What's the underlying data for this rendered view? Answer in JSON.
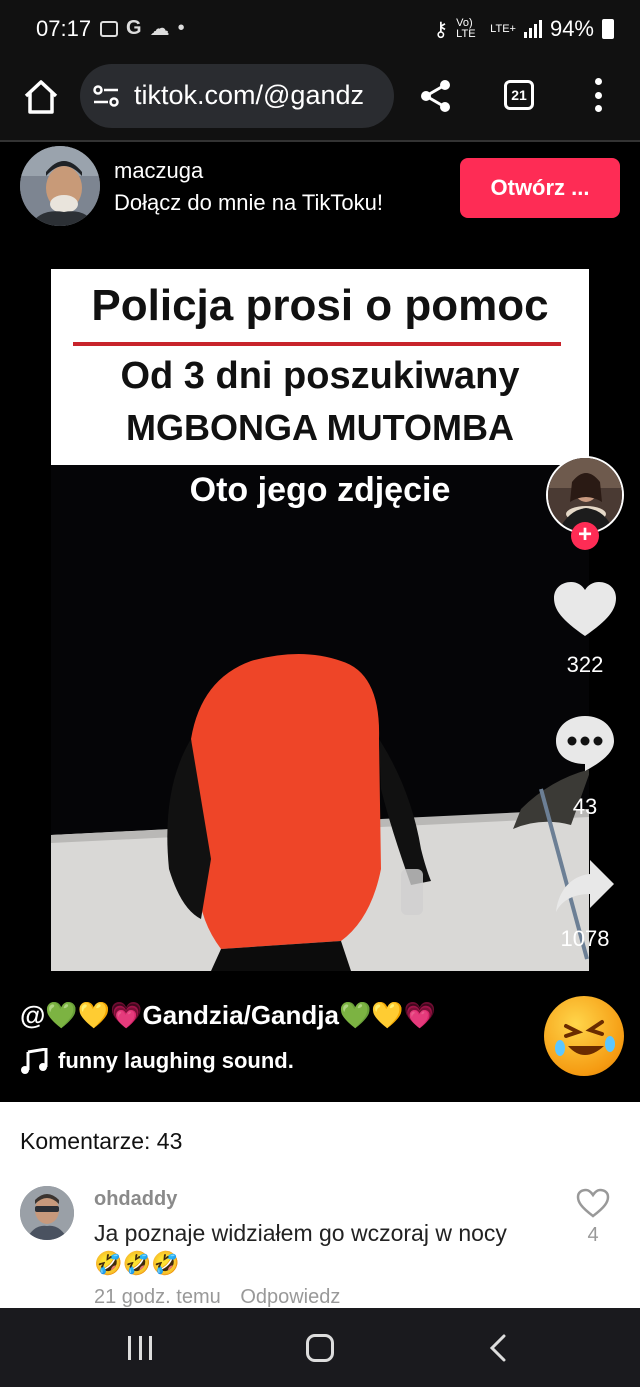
{
  "status_bar": {
    "time": "07:17",
    "left_icons": [
      "calendar-icon",
      "google-icon",
      "cloud-icon",
      "dot-icon"
    ],
    "network": "Vo) LTE",
    "data": "LTE+",
    "battery": "94%"
  },
  "browser": {
    "url": "tiktok.com/@gandz",
    "tab_count": "21"
  },
  "profile": {
    "username": "maczuga",
    "invite_text": "Dołącz do mnie na TikToku!",
    "open_button": "Otwórz ..."
  },
  "video": {
    "headline": "Policja prosi o pomoc",
    "line2": "Od 3 dni poszukiwany",
    "line3": "MGBONGA MUTOMBA",
    "caption": "Oto jego zdjęcie"
  },
  "actions": {
    "likes": "322",
    "comments": "43",
    "shares": "1078"
  },
  "post": {
    "author_credit": "@💚💛💗Gandzia/Gandja💚💛💗",
    "sound": "funny laughing sound."
  },
  "comments_section": {
    "heading": "Komentarze: 43",
    "items": [
      {
        "user": "ohdaddy",
        "text": "Ja poznaje widziałem go wczoraj w nocy🤣🤣🤣",
        "time": "21 godz. temu",
        "reply": "Odpowiedz",
        "likes": "4"
      }
    ]
  },
  "colors": {
    "accent": "#fe2c55",
    "background": "#000000",
    "comment_bg": "#ffffff"
  }
}
